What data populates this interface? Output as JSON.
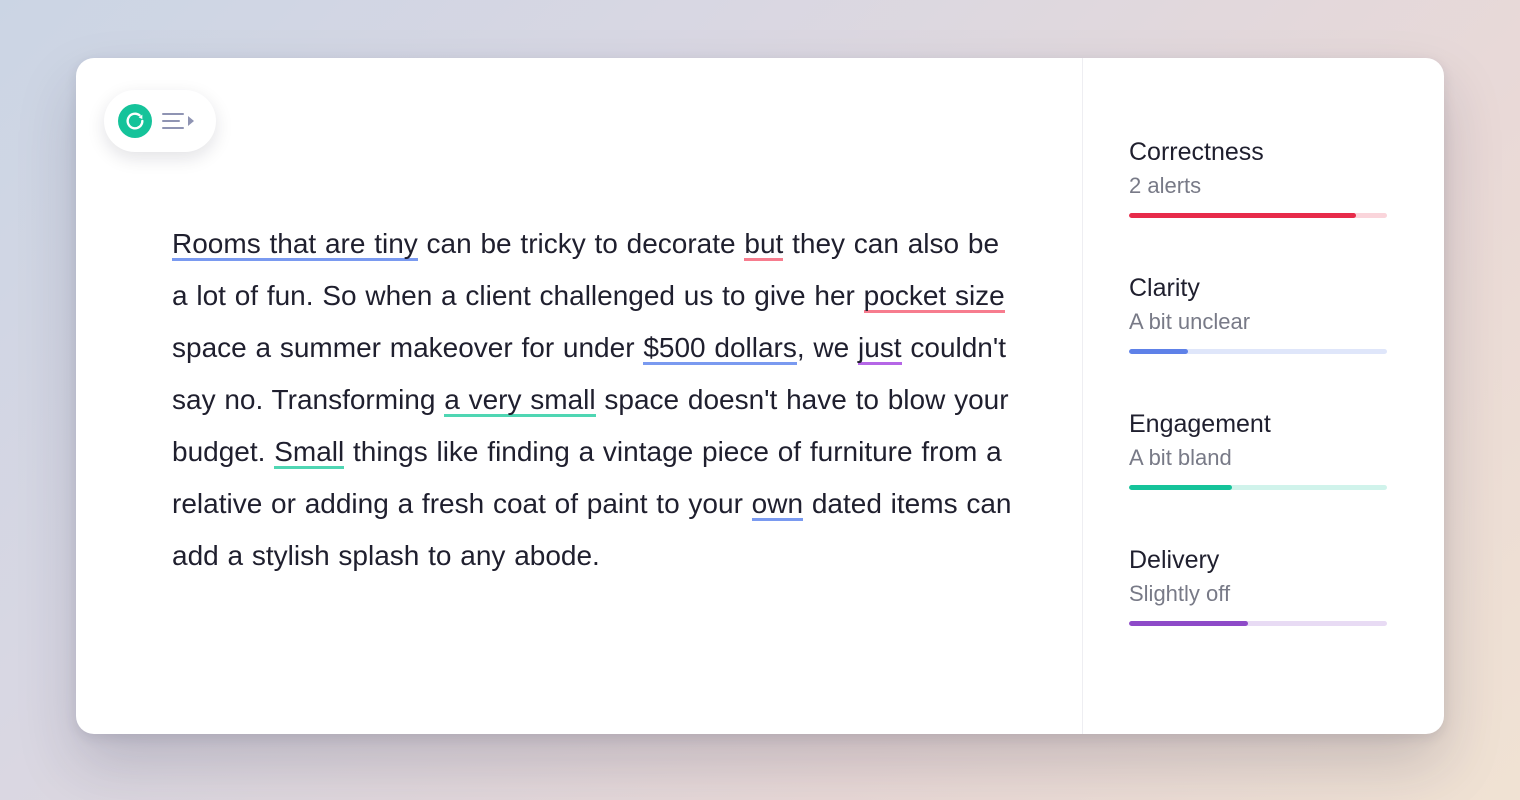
{
  "editor": {
    "segments": [
      {
        "text": "Rooms that are tiny",
        "underline": "blue"
      },
      {
        "text": " can be tricky to decorate "
      },
      {
        "text": "but",
        "underline": "red"
      },
      {
        "text": " they can also be a lot of fun.  So when a client challenged us to give her "
      },
      {
        "text": "pocket size",
        "underline": "red"
      },
      {
        "text": " space a summer makeover for under "
      },
      {
        "text": "$500 dollars",
        "underline": "blue"
      },
      {
        "text": ", we "
      },
      {
        "text": "just",
        "underline": "purple"
      },
      {
        "text": " couldn't say no. Transforming "
      },
      {
        "text": "a very small",
        "underline": "teal"
      },
      {
        "text": " space doesn't have to blow your budget. "
      },
      {
        "text": "Small",
        "underline": "teal"
      },
      {
        "text": " things like finding a vintage piece of furniture from a relative or adding a fresh coat of paint to your "
      },
      {
        "text": "own",
        "underline": "blue"
      },
      {
        "text": " dated items can add a stylish splash to any abode."
      }
    ]
  },
  "sidebar": {
    "metrics": [
      {
        "key": "correctness",
        "title": "Correctness",
        "subtitle": "2 alerts",
        "percent": 88,
        "color": "#e72b4a"
      },
      {
        "key": "clarity",
        "title": "Clarity",
        "subtitle": "A bit unclear",
        "percent": 23,
        "color": "#5e81e8"
      },
      {
        "key": "engagement",
        "title": "Engagement",
        "subtitle": "A bit bland",
        "percent": 40,
        "color": "#15c39a"
      },
      {
        "key": "delivery",
        "title": "Delivery",
        "subtitle": "Slightly off",
        "percent": 46,
        "color": "#8e4ac8"
      }
    ]
  },
  "icons": {
    "logo": "grammarly",
    "toc": "outline"
  }
}
